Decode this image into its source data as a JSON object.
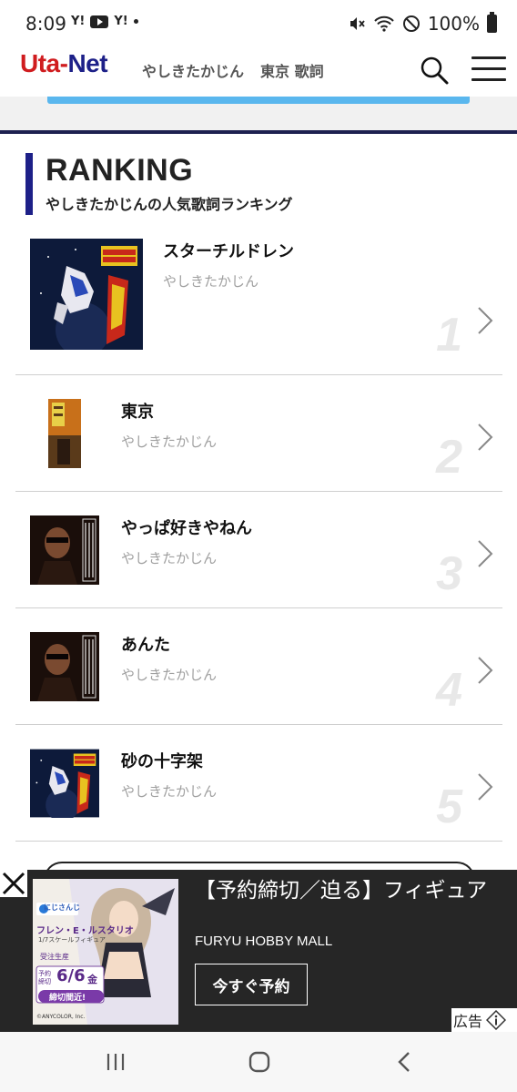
{
  "status_bar": {
    "time": "8:09",
    "app_icons": [
      "Y!",
      "youtube",
      "Y!"
    ],
    "battery": "100%"
  },
  "header": {
    "logo_part1": "Uta-",
    "logo_part2": "Net",
    "links": [
      "やしきたかじん",
      "東京 歌詞"
    ]
  },
  "section": {
    "title": "RANKING",
    "subtitle": "やしきたかじんの人気歌詞ランキング"
  },
  "ranking": [
    {
      "rank": "1",
      "title": "スターチルドレン",
      "artist": "やしきたかじん",
      "thumb": "gundam-jacket"
    },
    {
      "rank": "2",
      "title": "東京",
      "artist": "やしきたかじん",
      "thumb": "tokyo-jacket"
    },
    {
      "rank": "3",
      "title": "やっぱ好きやねん",
      "artist": "やしきたかじん",
      "thumb": "takajin-jacket"
    },
    {
      "rank": "4",
      "title": "あんた",
      "artist": "やしきたかじん",
      "thumb": "takajin-jacket"
    },
    {
      "rank": "5",
      "title": "砂の十字架",
      "artist": "やしきたかじん",
      "thumb": "gundam-jacket"
    }
  ],
  "ad": {
    "title": "【予約締切／迫る】フィギュア",
    "sponsor": "FURYU HOBBY MALL",
    "cta": "今すぐ予約",
    "label": "広告",
    "image_text": {
      "brand": "にじさんじ",
      "product": "フレン・E・ルスタリオ",
      "scale": "1/7スケールフィギュア",
      "order": "受注生産",
      "deadline_label": "予約締切",
      "deadline": "6/6",
      "day": "金",
      "soon": "締切間近!",
      "copyright": "©ANYCOLOR, Inc."
    }
  },
  "colors": {
    "logo_red": "#d01c1f",
    "logo_navy": "#1d2088",
    "accent_blue": "#5ab7ee",
    "rank_number": "#e8e8e8",
    "ad_background": "#262626"
  }
}
